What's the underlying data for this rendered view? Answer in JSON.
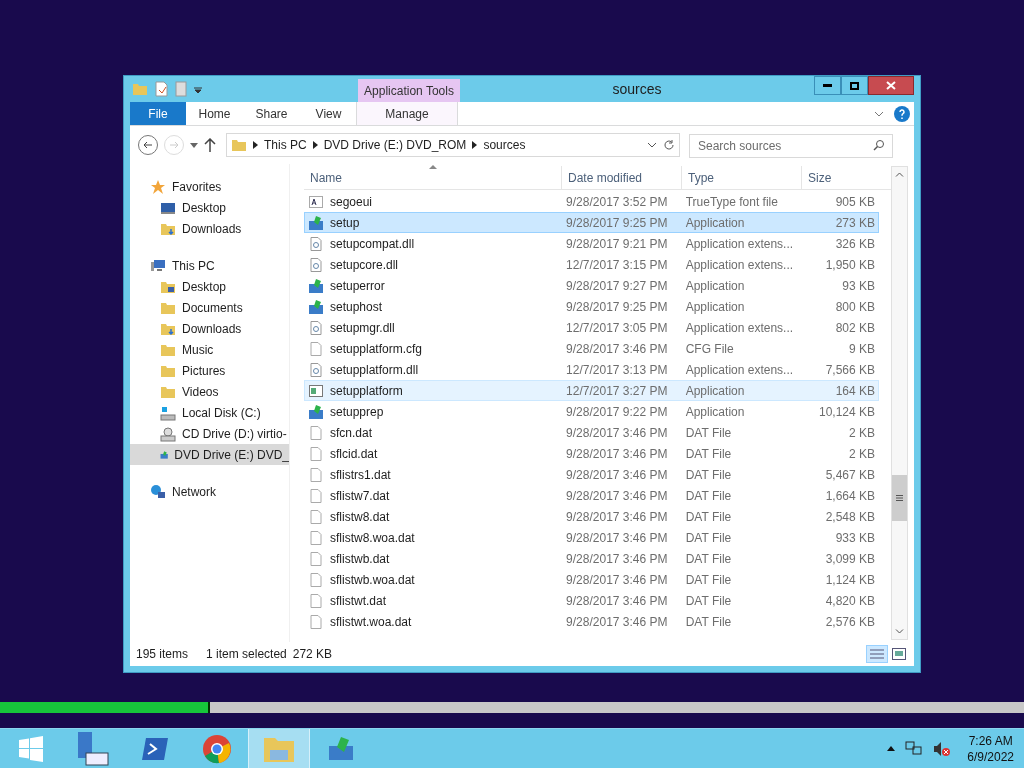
{
  "title_bar": {
    "contextual_tab": "Application Tools",
    "title": "sources"
  },
  "ribbon_tabs": [
    {
      "label": "File",
      "kind": "file",
      "selected": false
    },
    {
      "label": "Home",
      "kind": "tab",
      "selected": false
    },
    {
      "label": "Share",
      "kind": "tab",
      "selected": false
    },
    {
      "label": "View",
      "kind": "tab",
      "selected": false
    },
    {
      "label": "Manage",
      "kind": "contextual",
      "selected": false
    }
  ],
  "address": {
    "crumbs": [
      "This PC",
      "DVD Drive (E:) DVD_ROM",
      "sources"
    ]
  },
  "search": {
    "placeholder": "Search sources"
  },
  "nav": [
    {
      "label": "Favorites",
      "kind": "star",
      "selected": false,
      "children": [
        {
          "label": "Desktop",
          "kind": "desktop",
          "selected": false
        },
        {
          "label": "Downloads",
          "kind": "downloads",
          "selected": false
        }
      ]
    },
    {
      "label": "This PC",
      "kind": "computer",
      "selected": false,
      "children": [
        {
          "label": "Desktop",
          "kind": "desktop-folder",
          "selected": false
        },
        {
          "label": "Documents",
          "kind": "folder",
          "selected": false
        },
        {
          "label": "Downloads",
          "kind": "downloads",
          "selected": false
        },
        {
          "label": "Music",
          "kind": "folder",
          "selected": false
        },
        {
          "label": "Pictures",
          "kind": "folder",
          "selected": false
        },
        {
          "label": "Videos",
          "kind": "folder",
          "selected": false
        },
        {
          "label": "Local Disk (C:)",
          "kind": "disk",
          "selected": false
        },
        {
          "label": "CD Drive (D:) virtio-",
          "kind": "cd",
          "selected": false
        },
        {
          "label": "DVD Drive (E:) DVD_",
          "kind": "dvd",
          "selected": true
        }
      ]
    },
    {
      "label": "Network",
      "kind": "network",
      "selected": false
    }
  ],
  "columns": [
    {
      "label": "Name",
      "sorted": true
    },
    {
      "label": "Date modified",
      "sorted": false
    },
    {
      "label": "Type",
      "sorted": false
    },
    {
      "label": "Size",
      "sorted": false
    }
  ],
  "rows": [
    {
      "name": "segoeui",
      "kind": "font",
      "date": "9/28/2017 3:52 PM",
      "type": "TrueType font file",
      "size": "905 KB",
      "selected": false,
      "hovered": false
    },
    {
      "name": "setup",
      "kind": "setup",
      "date": "9/28/2017 9:25 PM",
      "type": "Application",
      "size": "273 KB",
      "selected": true,
      "hovered": false
    },
    {
      "name": "setupcompat.dll",
      "kind": "dll",
      "date": "9/28/2017 9:21 PM",
      "type": "Application extens...",
      "size": "326 KB",
      "selected": false,
      "hovered": false
    },
    {
      "name": "setupcore.dll",
      "kind": "dll",
      "date": "12/7/2017 3:15 PM",
      "type": "Application extens...",
      "size": "1,950 KB",
      "selected": false,
      "hovered": false
    },
    {
      "name": "setuperror",
      "kind": "setup",
      "date": "9/28/2017 9:27 PM",
      "type": "Application",
      "size": "93 KB",
      "selected": false,
      "hovered": false
    },
    {
      "name": "setuphost",
      "kind": "setup",
      "date": "9/28/2017 9:25 PM",
      "type": "Application",
      "size": "800 KB",
      "selected": false,
      "hovered": false
    },
    {
      "name": "setupmgr.dll",
      "kind": "dll",
      "date": "12/7/2017 3:05 PM",
      "type": "Application extens...",
      "size": "802 KB",
      "selected": false,
      "hovered": false
    },
    {
      "name": "setupplatform.cfg",
      "kind": "blank",
      "date": "9/28/2017 3:46 PM",
      "type": "CFG File",
      "size": "9 KB",
      "selected": false,
      "hovered": false
    },
    {
      "name": "setupplatform.dll",
      "kind": "dll",
      "date": "12/7/2017 3:13 PM",
      "type": "Application extens...",
      "size": "7,566 KB",
      "selected": false,
      "hovered": false
    },
    {
      "name": "setupplatform",
      "kind": "window",
      "date": "12/7/2017 3:27 PM",
      "type": "Application",
      "size": "164 KB",
      "selected": false,
      "hovered": true
    },
    {
      "name": "setupprep",
      "kind": "setup",
      "date": "9/28/2017 9:22 PM",
      "type": "Application",
      "size": "10,124 KB",
      "selected": false,
      "hovered": false
    },
    {
      "name": "sfcn.dat",
      "kind": "blank",
      "date": "9/28/2017 3:46 PM",
      "type": "DAT File",
      "size": "2 KB",
      "selected": false,
      "hovered": false
    },
    {
      "name": "sflcid.dat",
      "kind": "blank",
      "date": "9/28/2017 3:46 PM",
      "type": "DAT File",
      "size": "2 KB",
      "selected": false,
      "hovered": false
    },
    {
      "name": "sflistrs1.dat",
      "kind": "blank",
      "date": "9/28/2017 3:46 PM",
      "type": "DAT File",
      "size": "5,467 KB",
      "selected": false,
      "hovered": false
    },
    {
      "name": "sflistw7.dat",
      "kind": "blank",
      "date": "9/28/2017 3:46 PM",
      "type": "DAT File",
      "size": "1,664 KB",
      "selected": false,
      "hovered": false
    },
    {
      "name": "sflistw8.dat",
      "kind": "blank",
      "date": "9/28/2017 3:46 PM",
      "type": "DAT File",
      "size": "2,548 KB",
      "selected": false,
      "hovered": false
    },
    {
      "name": "sflistw8.woa.dat",
      "kind": "blank",
      "date": "9/28/2017 3:46 PM",
      "type": "DAT File",
      "size": "933 KB",
      "selected": false,
      "hovered": false
    },
    {
      "name": "sflistwb.dat",
      "kind": "blank",
      "date": "9/28/2017 3:46 PM",
      "type": "DAT File",
      "size": "3,099 KB",
      "selected": false,
      "hovered": false
    },
    {
      "name": "sflistwb.woa.dat",
      "kind": "blank",
      "date": "9/28/2017 3:46 PM",
      "type": "DAT File",
      "size": "1,124 KB",
      "selected": false,
      "hovered": false
    },
    {
      "name": "sflistwt.dat",
      "kind": "blank",
      "date": "9/28/2017 3:46 PM",
      "type": "DAT File",
      "size": "4,820 KB",
      "selected": false,
      "hovered": false
    },
    {
      "name": "sflistwt.woa.dat",
      "kind": "blank",
      "date": "9/28/2017 3:46 PM",
      "type": "DAT File",
      "size": "2,576 KB",
      "selected": false,
      "hovered": false
    }
  ],
  "status": {
    "count": "195 items",
    "selection": "1 item selected",
    "size": "272 KB"
  },
  "progress": {
    "level": 0.205
  },
  "taskbar": {
    "apps": [
      {
        "kind": "start",
        "active": false
      },
      {
        "kind": "server",
        "active": false
      },
      {
        "kind": "shell",
        "active": false
      },
      {
        "kind": "browser",
        "active": false
      },
      {
        "kind": "explorer",
        "active": true
      },
      {
        "kind": "setup",
        "active": false
      }
    ],
    "time": "7:26 AM",
    "date": "6/9/2022"
  }
}
